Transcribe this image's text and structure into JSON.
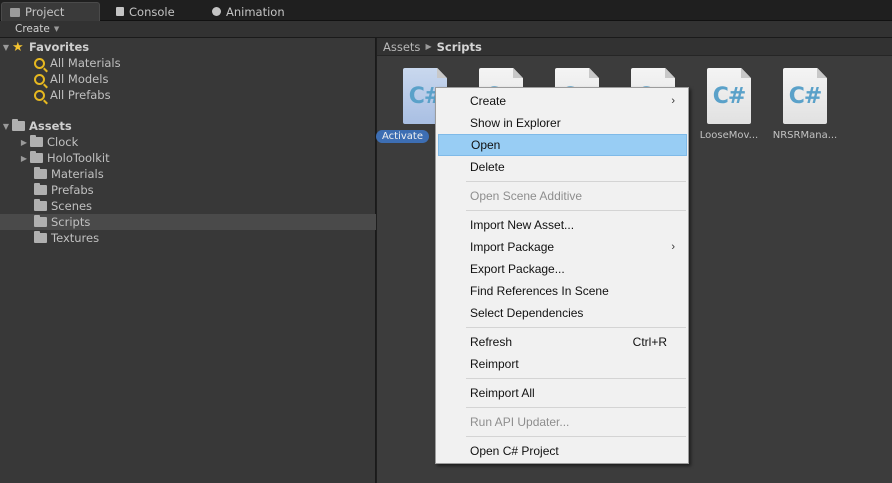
{
  "tabs": [
    {
      "label": "Project",
      "icon": "folder-icon",
      "active": true
    },
    {
      "label": "Console",
      "icon": "console-icon",
      "active": false
    },
    {
      "label": "Animation",
      "icon": "animation-icon",
      "active": false
    }
  ],
  "toolbar": {
    "create_label": "Create"
  },
  "favorites": {
    "label": "Favorites",
    "items": [
      "All Materials",
      "All Models",
      "All Prefabs"
    ]
  },
  "assets": {
    "label": "Assets",
    "items": [
      "Clock",
      "HoloToolkit",
      "Materials",
      "Prefabs",
      "Scenes",
      "Scripts",
      "Textures"
    ]
  },
  "breadcrumb": {
    "root": "Assets",
    "current": "Scripts"
  },
  "files": [
    {
      "name": "Activate",
      "selected": true
    },
    {
      "name": "",
      "selected": false
    },
    {
      "name": "",
      "selected": false
    },
    {
      "name": "",
      "selected": false
    },
    {
      "name": "LooseMov...",
      "selected": false
    },
    {
      "name": "NRSRMana...",
      "selected": false
    }
  ],
  "context_menu": {
    "items": [
      {
        "label": "Create",
        "submenu": true
      },
      {
        "label": "Show in Explorer"
      },
      {
        "label": "Open",
        "highlighted": true
      },
      {
        "label": "Delete"
      },
      {
        "label": "Open Scene Additive",
        "disabled": true
      },
      {
        "label": "Import New Asset..."
      },
      {
        "label": "Import Package",
        "submenu": true
      },
      {
        "label": "Export Package..."
      },
      {
        "label": "Find References In Scene"
      },
      {
        "label": "Select Dependencies"
      },
      {
        "label": "Refresh",
        "shortcut": "Ctrl+R"
      },
      {
        "label": "Reimport"
      },
      {
        "label": "Reimport All"
      },
      {
        "label": "Run API Updater...",
        "disabled": true
      },
      {
        "label": "Open C# Project"
      }
    ]
  },
  "colors": {
    "selection": "#3d6eb3",
    "menu_highlight": "#98cdf4",
    "favorite_star": "#f2c230"
  }
}
